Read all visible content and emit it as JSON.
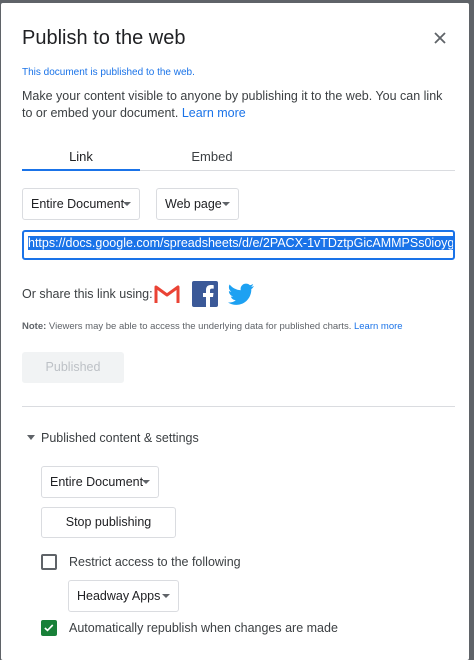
{
  "dialog": {
    "title": "Publish to the web",
    "notice": "This document is published to the web.",
    "description": "Make your content visible to anyone by publishing it to the web. You can link to or embed your document.",
    "learn_more": "Learn more",
    "close_icon": "close-icon"
  },
  "tabs": [
    {
      "label": "Link",
      "active": true
    },
    {
      "label": "Embed",
      "active": false
    }
  ],
  "link": {
    "scope_select": "Entire Document",
    "format_select": "Web page",
    "url": "https://docs.google.com/spreadsheets/d/e/2PACX-1vTDztpGicAMMPSs0ioyg",
    "share_label": "Or share this link using:",
    "share_icons": [
      "gmail-icon",
      "facebook-icon",
      "twitter-icon"
    ],
    "note_label": "Note:",
    "note_text": "Viewers may be able to access the underlying data for published charts.",
    "note_link": "Learn more",
    "published_button": "Published"
  },
  "settings": {
    "section_label": "Published content & settings",
    "scope_select": "Entire Document",
    "stop_button": "Stop publishing",
    "restrict_label": "Restrict access to the following",
    "restrict_checked": false,
    "org_select": "Headway Apps",
    "republish_label": "Automatically republish when changes are made",
    "republish_checked": true
  },
  "colors": {
    "accent": "#1a73e8",
    "check": "#188038",
    "gmail": "#ea4335",
    "facebook": "#3b5998",
    "twitter": "#1da1f2"
  }
}
